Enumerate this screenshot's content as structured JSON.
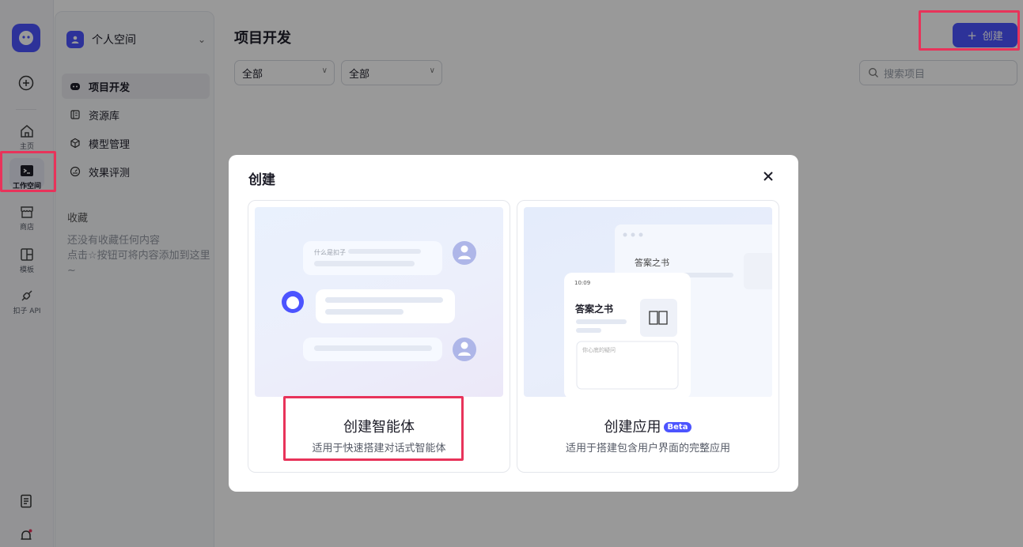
{
  "rail": {
    "items": [
      {
        "label": "主页",
        "icon": "home-icon"
      },
      {
        "label": "工作空间",
        "icon": "terminal-icon"
      },
      {
        "label": "商店",
        "icon": "store-icon"
      },
      {
        "label": "模板",
        "icon": "template-icon"
      },
      {
        "label": "扣子 API",
        "icon": "api-icon"
      }
    ]
  },
  "sidebar": {
    "space_name": "个人空间",
    "nav": [
      {
        "label": "项目开发",
        "icon": "bot-icon"
      },
      {
        "label": "资源库",
        "icon": "library-icon"
      },
      {
        "label": "模型管理",
        "icon": "model-icon"
      },
      {
        "label": "效果评测",
        "icon": "evaluation-icon"
      }
    ],
    "favorites_title": "收藏",
    "favorites_empty": "还没有收藏任何内容\n点击☆按钮可将内容添加到这里~"
  },
  "main": {
    "title": "项目开发",
    "create_label": "创建",
    "filters": [
      "全部",
      "全部"
    ],
    "search_placeholder": "搜索项目"
  },
  "modal": {
    "title": "创建",
    "cards": [
      {
        "title": "创建智能体",
        "desc": "适用于快速搭建对话式智能体",
        "art_question": "什么是扣子"
      },
      {
        "title": "创建应用",
        "badge": "Beta",
        "desc": "适用于搭建包含用户界面的完整应用",
        "art_book": "答案之书",
        "art_time": "10:09",
        "art_input": "你心底的疑问"
      }
    ]
  },
  "colors": {
    "accent": "#4c54ff",
    "highlight": "#e8335a"
  }
}
